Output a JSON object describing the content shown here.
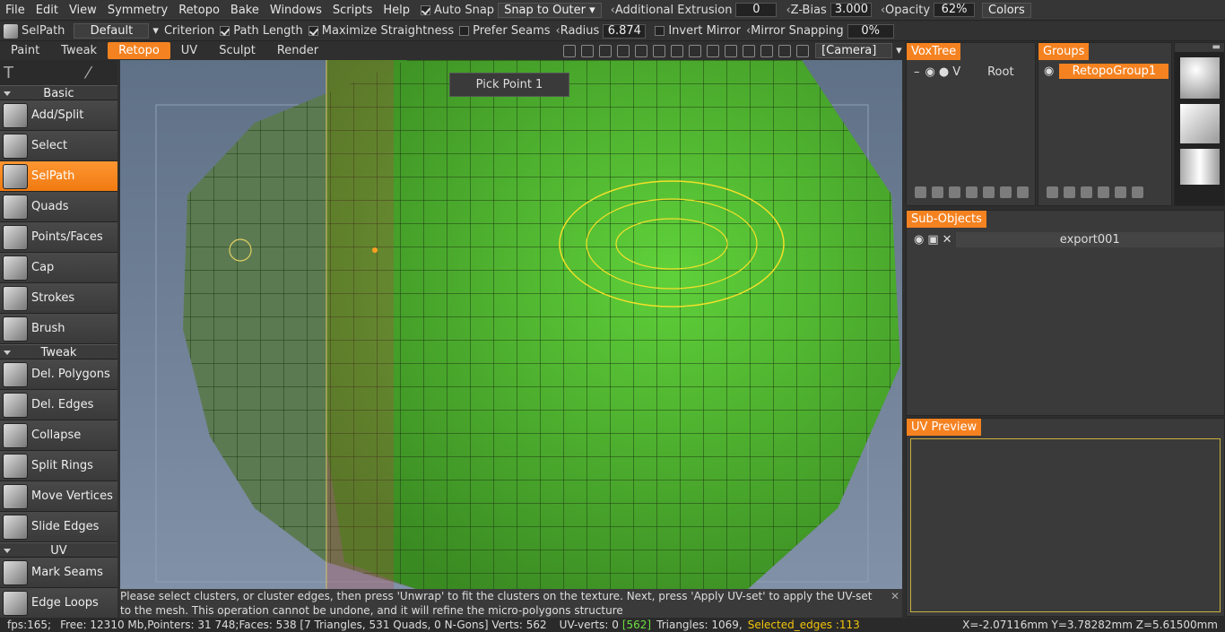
{
  "menubar": {
    "items": [
      "File",
      "Edit",
      "View",
      "Symmetry",
      "Retopo",
      "Bake",
      "Windows",
      "Scripts",
      "Help"
    ],
    "auto_snap_label": "Auto Snap",
    "snap_mode": "Snap to Outer",
    "additional_extrusion_label": "Additional Extrusion",
    "additional_extrusion_value": "0",
    "zbias_label": "Z-Bias",
    "zbias_value": "3.000",
    "opacity_label": "Opacity",
    "opacity_value": "62%",
    "colors_label": "Colors"
  },
  "tool_options": {
    "tool_name": "SelPath",
    "preset": "Default",
    "criterion_label": "Criterion",
    "path_length_label": "Path Length",
    "maximize_label": "Maximize Straightness",
    "prefer_seams_label": "Prefer Seams",
    "radius_label": "Radius",
    "radius_value": "6.874",
    "invert_mirror_label": "Invert Mirror",
    "mirror_snapping_label": "Mirror Snapping",
    "mirror_snapping_value": "0%"
  },
  "tabs": [
    "Paint",
    "Tweak",
    "Retopo",
    "UV",
    "Sculpt",
    "Render"
  ],
  "camera_label": "[Camera]",
  "left_panel": {
    "sections": [
      {
        "title": "Basic",
        "tools": [
          "Add/Split",
          "Select",
          "SelPath",
          "Quads",
          "Points/Faces",
          "Cap",
          "Strokes",
          "Brush"
        ]
      },
      {
        "title": "Tweak",
        "tools": [
          "Del. Polygons",
          "Del. Edges",
          "Collapse",
          "Split Rings",
          "Move Vertices",
          "Slide Edges"
        ]
      },
      {
        "title": "UV",
        "tools": [
          "Mark Seams",
          "Edge Loops"
        ]
      }
    ],
    "active_tool": "SelPath"
  },
  "viewport": {
    "pick_point_label": "Pick Point 1",
    "hint_text": "Please select clusters, or cluster edges, then press 'Unwrap' to fit the clusters on the texture. Next, press 'Apply UV-set' to apply the UV-set to the mesh. This operation cannot be undone, and it will refine the micro-polygons structure",
    "close_icon": "✕"
  },
  "voxtree": {
    "title": "VoxTree",
    "root_label": "Root",
    "v_label": "V"
  },
  "groups": {
    "title": "Groups",
    "item": "RetopoGroup1"
  },
  "subobjects": {
    "title": "Sub-Objects",
    "item": "export001"
  },
  "uv_preview": {
    "title": "UV Preview"
  },
  "status": {
    "fps": "fps:165;",
    "free": "Free: 12310 Mb,Pointers: 31 748;Faces: 538 [7 Triangles, 531 Quads, 0 N-Gons] Verts: 562",
    "uv_verts": "UV-verts: 0",
    "uv_verts_bracket": "[562]",
    "triangles": "Triangles: 1069,",
    "selected": "Selected_edges :113",
    "coords": "X=-2.07116mm  Y=3.78282mm  Z=5.61500mm"
  },
  "colors": {
    "accent": "#f58220",
    "mesh_green": "#4caf2e",
    "selection_yellow": "#f2e02a",
    "bg": "#2f2f2f"
  }
}
